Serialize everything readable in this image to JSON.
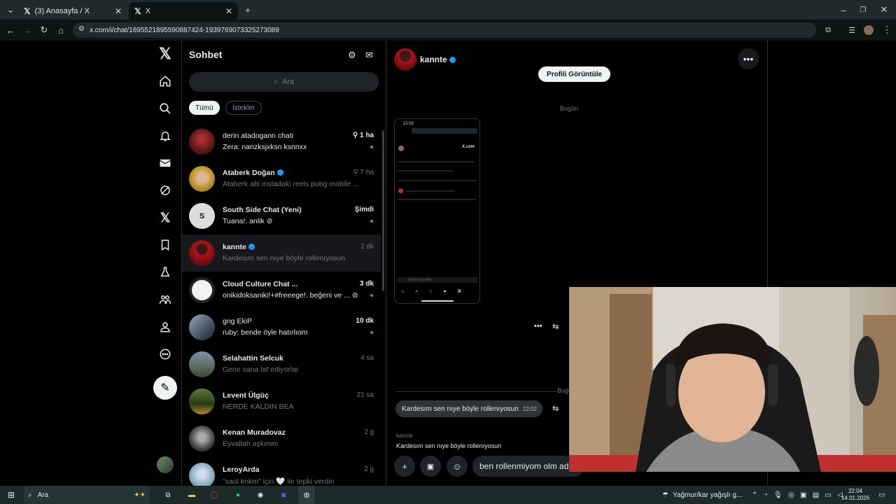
{
  "browser": {
    "tabs": [
      {
        "label": "(3) Anasayfa / X",
        "active": false
      },
      {
        "label": "X",
        "active": true
      }
    ],
    "url": "x.com/i/chat/1695521895590887424-1939769073325273089"
  },
  "chat_list": {
    "title": "Sohbet",
    "search_placeholder": "Ara",
    "filters": [
      "Tümü",
      "İstekler"
    ],
    "rows": [
      {
        "name": "derin atadogann chati",
        "time": "1 ha",
        "message": "Zera: nanzksjxksn ksnnxx",
        "pinned": true,
        "unread": true
      },
      {
        "name": "Ataberk Doğan",
        "time": "7 ha",
        "message": "Ataberk abi instadaki reels pubg mobile ...",
        "pinned": true,
        "verified": true
      },
      {
        "name": "South Side Chat (Yeni)",
        "time": "Şimdi",
        "message": "Tuana!: anlik",
        "unread": true
      },
      {
        "name": "kannte",
        "time": "2 dk",
        "message": "Kardesım sen nıye böyle rollenıyosun",
        "verified": true,
        "selected": true
      },
      {
        "name": "Cloud Culture Chat ...",
        "time": "3 dk",
        "message": "onikidoksaniki!+#freeege!: beğeni ve ...",
        "unread": true
      },
      {
        "name": "gng EkiP",
        "time": "10 dk",
        "message": "ruby: bende öyle hatırlıom",
        "unread": true
      },
      {
        "name": "Selahattin Selcuk",
        "time": "4 sa",
        "message": "Gene sana laf ediyorlar"
      },
      {
        "name": "Levent Ülgüç",
        "time": "21 sa",
        "message": "NERDE KALDIN BEA"
      },
      {
        "name": "Kenan Muradovaz",
        "time": "2 g",
        "message": "Eyvallah aşkımm"
      },
      {
        "name": "LeroyArda",
        "time": "2 g",
        "message": "\"saol knkm\" için 🤍 ile tepki verdin"
      }
    ]
  },
  "conversation": {
    "name": "kannte",
    "profile_button": "Profili Görüntüle",
    "day_label": "Bugün",
    "day_label_2": "Bugün",
    "message_text": "Kardesım sen nıye böyle rollenıyosun",
    "message_time": "22:02",
    "reply_user": "kannte",
    "reply_text": "Kardesım sen nıye böyle rollenıyosun",
    "composer_text": "ben rollenmiyom olm ada",
    "screenshot_labels": {
      "status_time": "21:02",
      "brand": "X.com",
      "reply_hint": "Yanıtını gönder"
    }
  },
  "taskbar": {
    "search": "Ara",
    "weather": "Yağmur/kar yağışlı g...",
    "time": "22:04",
    "date": "14.01.2026"
  },
  "colors": {
    "accent": "#1d9bf0",
    "online": "#00ba7c",
    "background": "#000000"
  }
}
